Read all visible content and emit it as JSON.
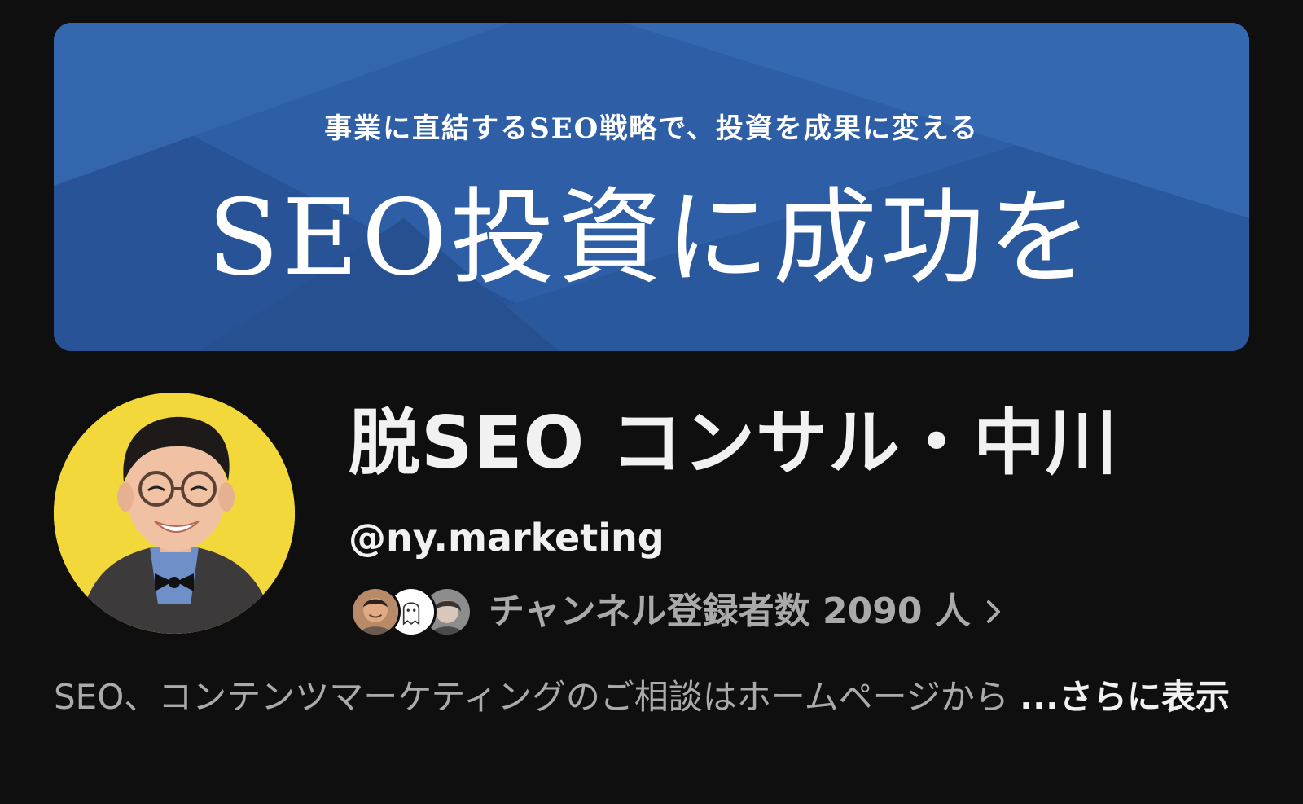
{
  "banner": {
    "tagline": "事業に直結するSEO戦略で、投資を成果に変える",
    "headline": "SEO投資に成功を",
    "colors": {
      "base": "#2d5ea5",
      "light": "#3a6db6",
      "dark": "#24508f"
    }
  },
  "channel": {
    "name": "脱SEO コンサル・中川",
    "handle": "@ny.marketing",
    "subscribers_text": "チャンネル登録者数 2090 人",
    "avatar_icon": "profile-photo",
    "avatar_bg": "#f2d83a"
  },
  "subscriber_avatars": [
    {
      "icon": "subscriber-avatar"
    },
    {
      "icon": "ghost-avatar"
    },
    {
      "icon": "subscriber-avatar"
    }
  ],
  "description": {
    "text": "SEO、コンテンツマーケティングのご相談はホームページから",
    "more_label": "...さらに表示"
  }
}
